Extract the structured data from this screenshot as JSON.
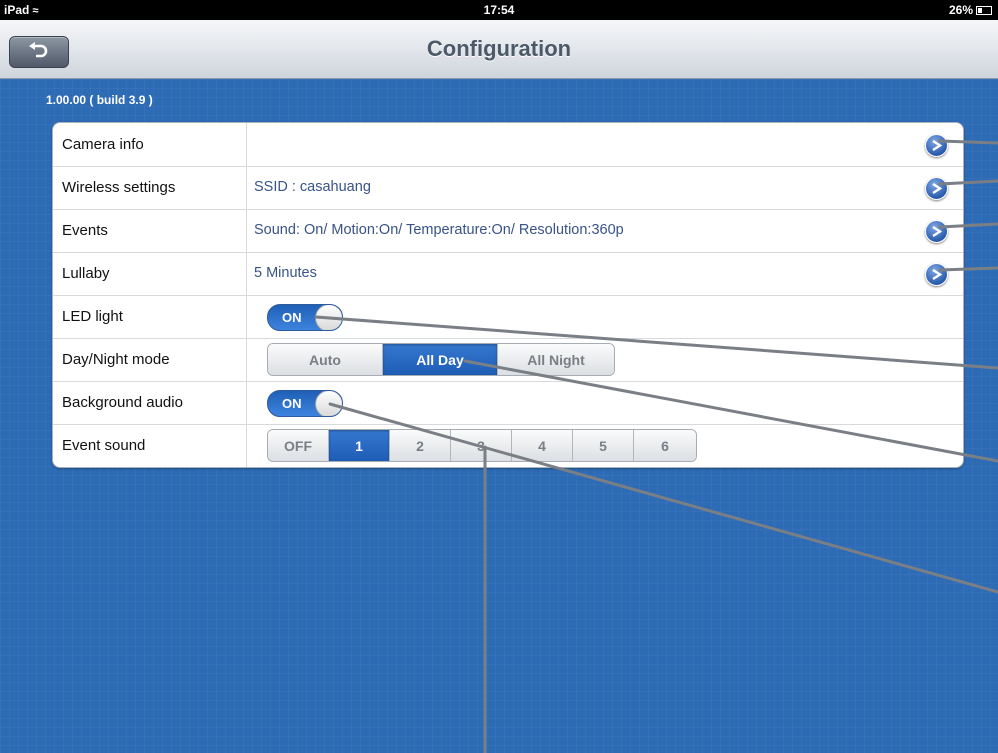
{
  "status_bar": {
    "device": "iPad",
    "time": "17:54",
    "battery": "26%"
  },
  "nav": {
    "title": "Configuration",
    "back_icon": "back-arrow-icon"
  },
  "version": "1.00.00 ( build 3.9 )",
  "settings": {
    "camera_info": {
      "label": "Camera info",
      "value": ""
    },
    "wireless": {
      "label": "Wireless settings",
      "value": "SSID : casahuang"
    },
    "events": {
      "label": "Events",
      "value": "Sound: On/ Motion:On/ Temperature:On/ Resolution:360p"
    },
    "lullaby": {
      "label": "Lullaby",
      "value": "5 Minutes"
    },
    "led_light": {
      "label": "LED light",
      "switch": "ON"
    },
    "day_night": {
      "label": "Day/Night mode",
      "options": [
        "Auto",
        "All Day",
        "All Night"
      ],
      "selected": "All Day"
    },
    "background_audio": {
      "label": "Background audio",
      "switch": "ON"
    },
    "event_sound": {
      "label": "Event sound",
      "options": [
        "OFF",
        "1",
        "2",
        "3",
        "4",
        "5",
        "6"
      ],
      "selected": "1"
    }
  },
  "colors": {
    "background": "#2e6bb5",
    "accent": "#1e5db6",
    "value_text": "#385487"
  }
}
